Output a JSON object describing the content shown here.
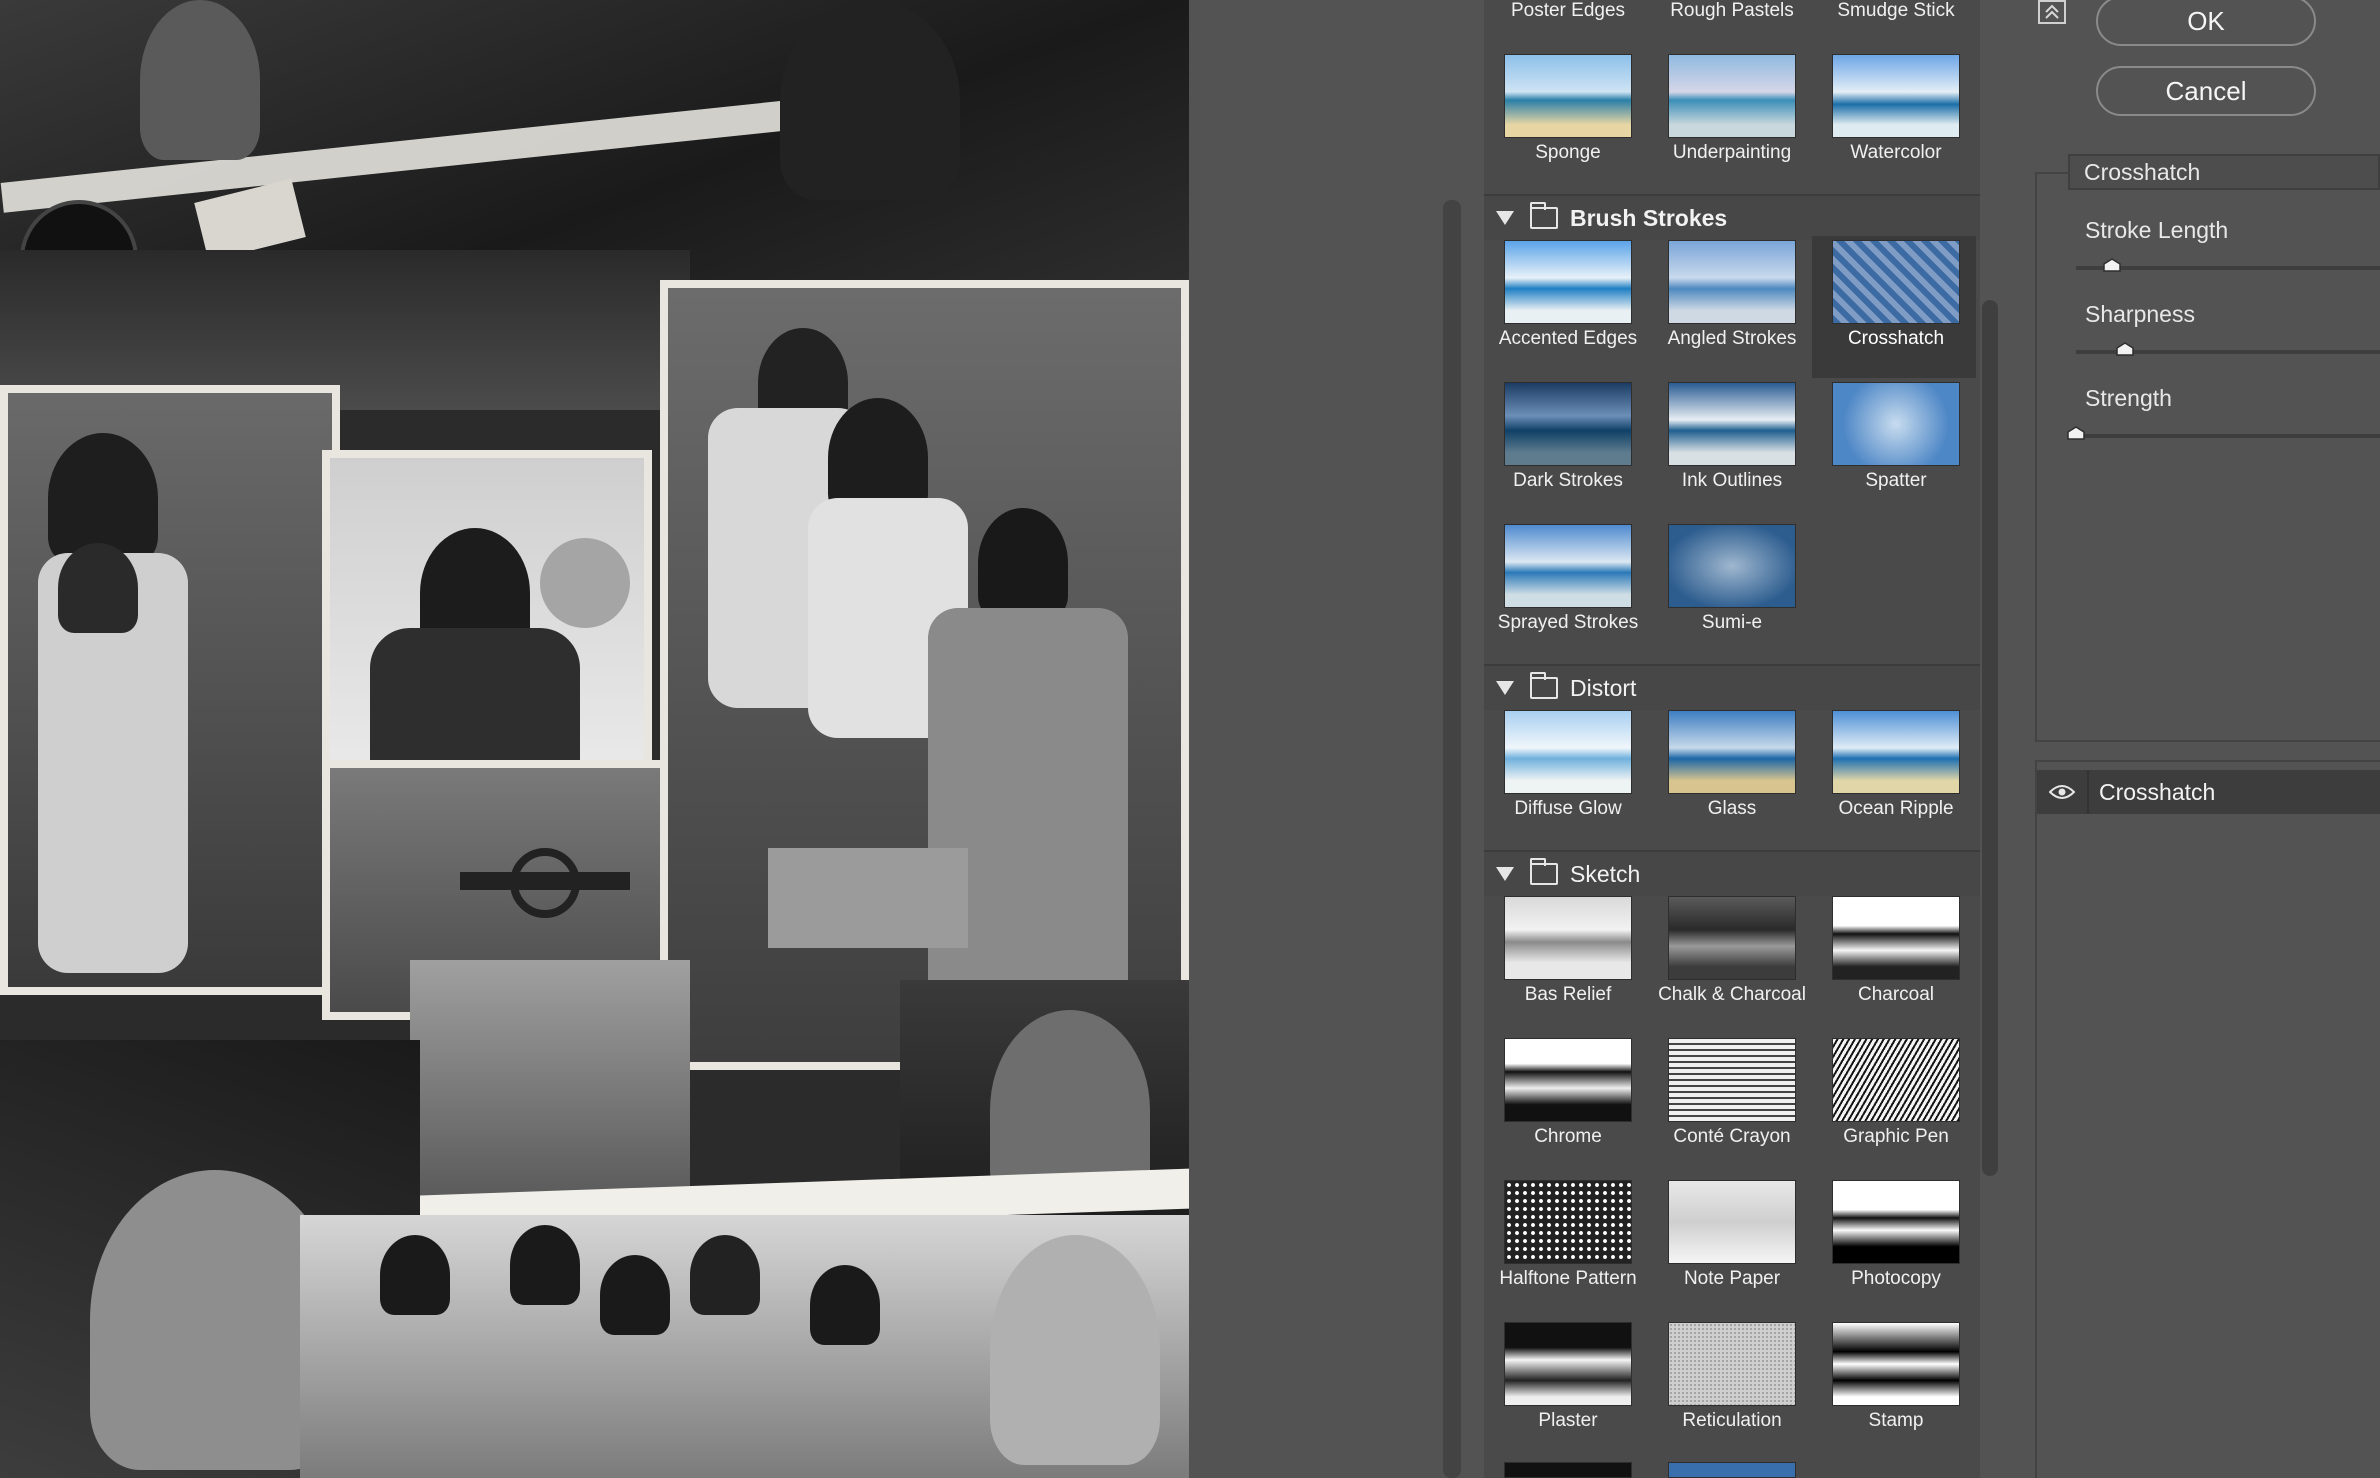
{
  "dialog": {
    "ok_label": "OK",
    "cancel_label": "Cancel"
  },
  "gallery": {
    "top_row": [
      "Poster Edges",
      "Rough Pastels",
      "Smudge Stick"
    ],
    "artistic_row": [
      "Sponge",
      "Underpainting",
      "Watercolor"
    ],
    "categories": [
      {
        "name": "Brush Strokes",
        "items": [
          "Accented Edges",
          "Angled Strokes",
          "Crosshatch",
          "Dark Strokes",
          "Ink Outlines",
          "Spatter",
          "Sprayed Strokes",
          "Sumi-e"
        ]
      },
      {
        "name": "Distort",
        "items": [
          "Diffuse Glow",
          "Glass",
          "Ocean Ripple"
        ]
      },
      {
        "name": "Sketch",
        "items": [
          "Bas Relief",
          "Chalk & Charcoal",
          "Charcoal",
          "Chrome",
          "Conté Crayon",
          "Graphic Pen",
          "Halftone Pattern",
          "Note Paper",
          "Photocopy",
          "Plaster",
          "Reticulation",
          "Stamp"
        ]
      }
    ],
    "selected": "Crosshatch"
  },
  "settings": {
    "filter_select_value": "Crosshatch",
    "params": [
      {
        "label": "Stroke Length",
        "level": 0.12
      },
      {
        "label": "Sharpness",
        "level": 0.16
      },
      {
        "label": "Strength",
        "level": 0.0
      }
    ]
  },
  "layers": {
    "active_layer_name": "Crosshatch"
  },
  "icons": {
    "visibility": "eye-icon",
    "collapse": "collapse-up-icon",
    "category_toggle": "triangle-down-icon",
    "category_folder": "folder-icon"
  }
}
